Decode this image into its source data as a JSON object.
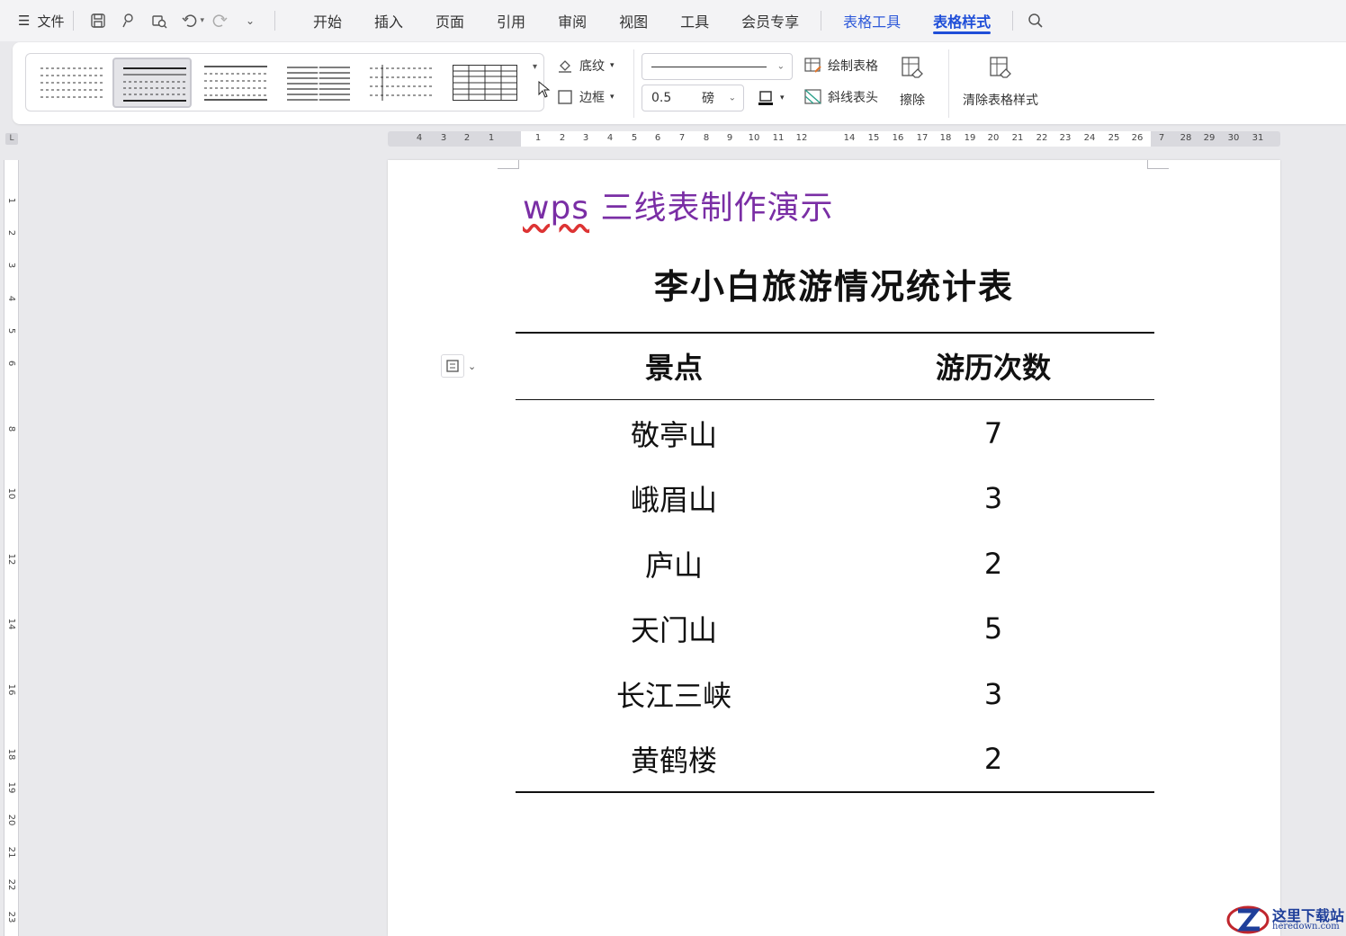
{
  "menubar": {
    "file_label": "文件",
    "tabs": [
      {
        "label": "开始"
      },
      {
        "label": "插入"
      },
      {
        "label": "页面"
      },
      {
        "label": "引用"
      },
      {
        "label": "审阅"
      },
      {
        "label": "视图"
      },
      {
        "label": "工具"
      },
      {
        "label": "会员专享"
      }
    ],
    "context_tabs": [
      {
        "label": "表格工具"
      },
      {
        "label": "表格样式"
      }
    ]
  },
  "ribbon": {
    "shading_label": "底纹",
    "border_label": "边框",
    "line_width_value": "0.5",
    "line_width_unit": "磅",
    "draw_table_label": "绘制表格",
    "diagonal_header_label": "斜线表头",
    "erase_label": "擦除",
    "clear_style_label": "清除表格样式"
  },
  "hruler_ticks": [
    "4",
    "3",
    "2",
    "1",
    "1",
    "2",
    "3",
    "4",
    "5",
    "6",
    "7",
    "8",
    "9",
    "10",
    "11",
    "12",
    "14",
    "15",
    "16",
    "17",
    "18",
    "19",
    "20",
    "21",
    "22",
    "23",
    "24",
    "25",
    "26",
    "7",
    "28",
    "29",
    "30",
    "31"
  ],
  "vruler_ticks": [
    "1",
    "2",
    "3",
    "4",
    "5",
    "6",
    "8",
    "10",
    "12",
    "14",
    "16",
    "18",
    "19",
    "20",
    "21",
    "22",
    "23"
  ],
  "document": {
    "heading": "wps 三线表制作演示",
    "heading_underlined": "wps",
    "heading_rest": " 三线表制作演示",
    "table_title": "李小白旅游情况统计表",
    "table": {
      "headers": [
        "景点",
        "游历次数"
      ],
      "rows": [
        [
          "敬亭山",
          "7"
        ],
        [
          "峨眉山",
          "3"
        ],
        [
          "庐山",
          "2"
        ],
        [
          "天门山",
          "5"
        ],
        [
          "长江三峡",
          "3"
        ],
        [
          "黄鹤楼",
          "2"
        ]
      ]
    }
  },
  "watermark": {
    "line1": "这里下载站",
    "line2": "heredown.com"
  },
  "colors": {
    "accent": "#1f4ed8",
    "heading": "#7a2ea5"
  }
}
